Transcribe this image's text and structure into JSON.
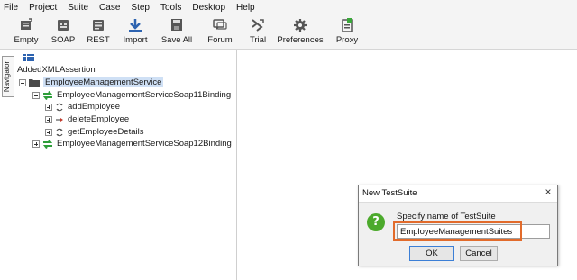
{
  "menu": {
    "items": [
      "File",
      "Project",
      "Suite",
      "Case",
      "Step",
      "Tools",
      "Desktop",
      "Help"
    ]
  },
  "toolbar": {
    "buttons": [
      {
        "label": "Empty",
        "icon": "new-project-icon"
      },
      {
        "label": "SOAP",
        "icon": "soap-icon"
      },
      {
        "label": "REST",
        "icon": "rest-icon"
      },
      {
        "label": "Import",
        "icon": "import-icon"
      },
      {
        "label": "Save All",
        "icon": "save-all-icon"
      },
      {
        "label": "Forum",
        "icon": "forum-icon"
      },
      {
        "label": "Trial",
        "icon": "trial-icon"
      },
      {
        "label": "Preferences",
        "icon": "preferences-icon"
      },
      {
        "label": "Proxy",
        "icon": "proxy-icon"
      }
    ]
  },
  "navigator": {
    "tab_label": "Navigator",
    "root_label": "AddedXMLAssertion",
    "tree": {
      "service": "EmployeeManagementService",
      "binding1": "EmployeeManagementServiceSoap11Binding",
      "operations": [
        "addEmployee",
        "deleteEmployee",
        "getEmployeeDetails"
      ],
      "binding2": "EmployeeManagementServiceSoap12Binding"
    }
  },
  "dialog": {
    "title": "New TestSuite",
    "prompt": "Specify name of TestSuite",
    "input_value": "EmployeeManagementSuites",
    "ok_label": "OK",
    "cancel_label": "Cancel"
  },
  "colors": {
    "accent_highlight": "#e26b2b",
    "selection": "#cfe0f5",
    "binding_green": "#2e9e3a",
    "question_green": "#4caa2c"
  }
}
